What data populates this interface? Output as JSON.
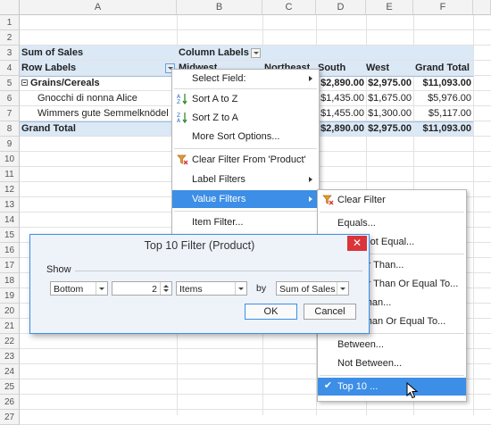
{
  "columns": [
    "A",
    "B",
    "C",
    "D",
    "E",
    "F"
  ],
  "rows": [
    "1",
    "2",
    "3",
    "4",
    "5",
    "6",
    "7",
    "8",
    "9",
    "10",
    "11",
    "12",
    "13",
    "14",
    "15",
    "16",
    "17",
    "18",
    "19",
    "20",
    "21",
    "22",
    "23",
    "24",
    "25",
    "26",
    "27"
  ],
  "pivot": {
    "sum_label": "Sum of Sales",
    "column_labels": "Column Labels",
    "row_labels": "Row Labels",
    "col_partial_b": "Midwest",
    "col_partial_c": "Northeast",
    "col_south": "South",
    "col_west": "West",
    "col_grand": "Grand Total",
    "group": "Grains/Cereals",
    "item1": "Gnocchi di nonna Alice",
    "item2": "Wimmers gute Semmelknödel",
    "grand_total": "Grand Total",
    "r5": {
      "south": "$2,890.00",
      "west": "$2,975.00",
      "grand": "$11,093.00"
    },
    "r6": {
      "south": "$1,435.00",
      "west": "$1,675.00",
      "grand": "$5,976.00"
    },
    "r7": {
      "south": "$1,455.00",
      "west": "$1,300.00",
      "grand": "$5,117.00"
    },
    "r8": {
      "south": "$2,890.00",
      "west": "$2,975.00",
      "grand": "$11,093.00"
    }
  },
  "context_menu": {
    "select_field": "Select Field:",
    "sort_az": "Sort A to Z",
    "sort_za": "Sort Z to A",
    "more_sort": "More Sort Options...",
    "clear_filter": "Clear Filter From 'Product'",
    "label_filters": "Label Filters",
    "value_filters": "Value Filters",
    "item_filter": "Item Filter..."
  },
  "submenu": {
    "clear_filter": "Clear Filter",
    "equals": "Equals...",
    "not_equal": "Does Not Equal...",
    "greater": "Greater Than...",
    "greater_eq": "Greater Than Or Equal To...",
    "less": "Less Than...",
    "less_eq": "Less Than Or Equal To...",
    "between": "Between...",
    "not_between": "Not Between...",
    "top10": "Top 10 ..."
  },
  "dialog": {
    "title": "Top 10 Filter (Product)",
    "close": "✕",
    "show_label": "Show",
    "direction": "Bottom",
    "count": "2",
    "unit": "Items",
    "by_label": "by",
    "field": "Sum of Sales",
    "ok": "OK",
    "cancel": "Cancel"
  },
  "colors": {
    "accent": "#3c8ee6",
    "band": "#dbe8f6",
    "close": "#d9353b"
  }
}
